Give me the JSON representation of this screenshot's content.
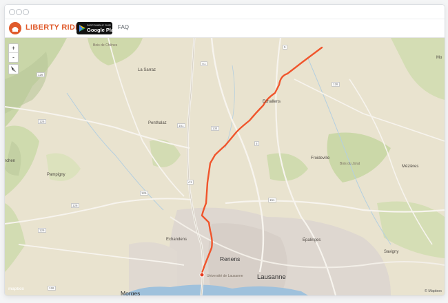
{
  "window": {
    "controls": [
      "close",
      "minimize",
      "maximize"
    ]
  },
  "navbar": {
    "brand": "LIBERTY RIDER",
    "brand_color": "#e05a2b",
    "store_badge_small": "DISPONIBLE SUR",
    "store_badge_big": "Google Play",
    "faq_label": "FAQ"
  },
  "map": {
    "zoom_in_label": "+",
    "zoom_out_label": "-",
    "route_color": "#f0552c",
    "labels": {
      "bois_de_chenes": "Bois de Chênes",
      "la_sarraz": "La Sarraz",
      "echallens": "Echallens",
      "penthalaz": "Penthalaz",
      "froideville": "Froideville",
      "mezieres": "Mézières",
      "pampigny": "Pampigny",
      "echandens": "Echandens",
      "renens": "Renens",
      "lausanne": "Lausanne",
      "epalinges": "Épalinges",
      "savigny": "Savigny",
      "universite": "Université de Lausanne",
      "mo": "Mo",
      "bois_du_jorat": "Bois du Jorat",
      "chene": "rchen",
      "morges": "Morges"
    },
    "road_shields": [
      "A1",
      "5",
      "1",
      "128",
      "126",
      "134",
      "5",
      "151",
      "126",
      "A1",
      "126",
      "151",
      "126",
      "126",
      "126"
    ],
    "attribution": "© Mapbox",
    "mapbox_logo": "mapbox"
  }
}
